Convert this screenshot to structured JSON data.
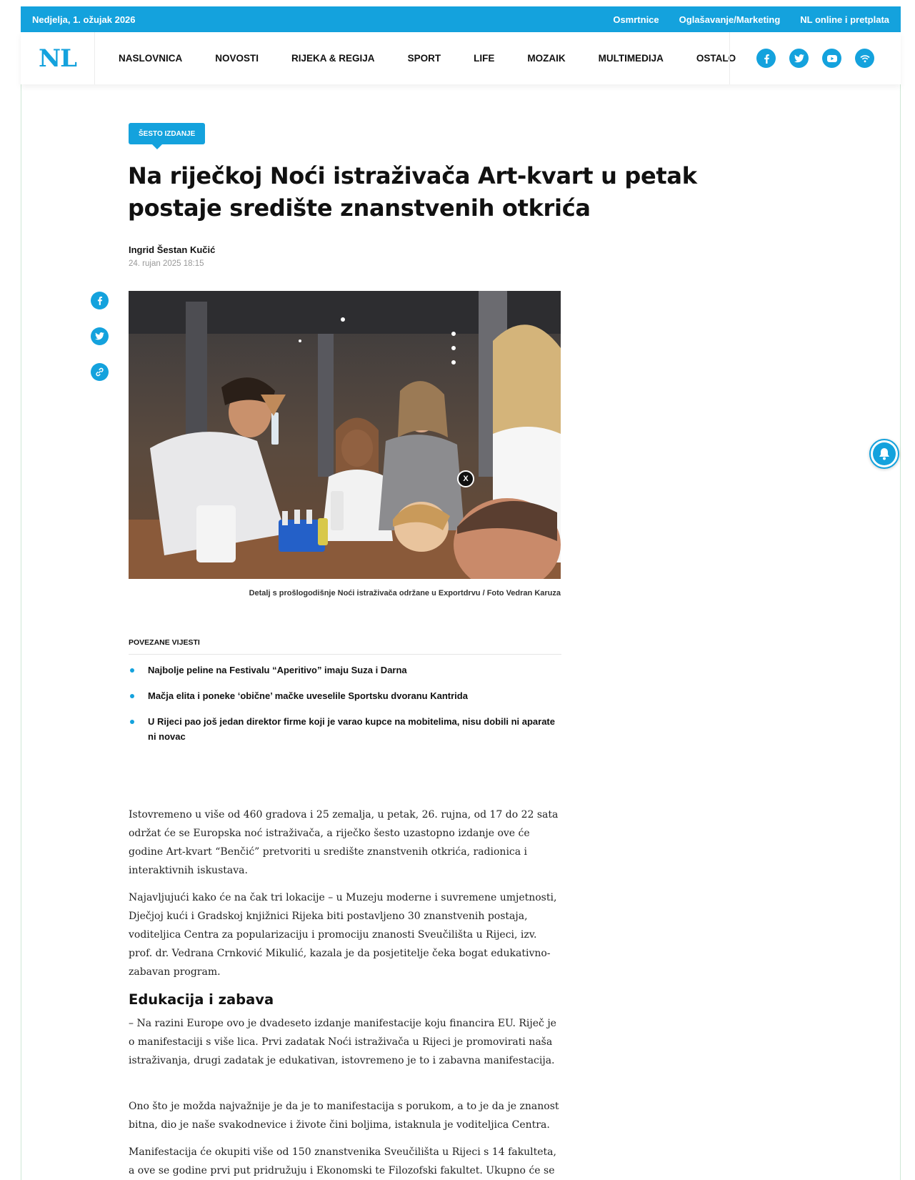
{
  "topbar": {
    "date": "Nedjelja, 1. ožujak 2026",
    "links": [
      "Osmrtnice",
      "Oglašavanje/Marketing",
      "NL online i pretplata"
    ]
  },
  "nav": {
    "logo": "NL",
    "items": [
      "NASLOVNICA",
      "NOVOSTI",
      "RIJEKA & REGIJA",
      "SPORT",
      "LIFE",
      "MOZAIK",
      "MULTIMEDIJA",
      "OSTALO"
    ],
    "social": [
      {
        "icon": "facebook-icon",
        "glyph": "f"
      },
      {
        "icon": "twitter-icon",
        "glyph": "t"
      },
      {
        "icon": "youtube-icon",
        "glyph": "▶"
      },
      {
        "icon": "rss-icon",
        "glyph": "◉"
      }
    ]
  },
  "article": {
    "badge": "ŠESTO IZDANJE",
    "title": "Na riječkoj Noći istraživača Art-kvart u petak postaje središte znanstvenih otkrića",
    "author": "Ingrid Šestan Kučić",
    "date": "24. rujan 2025 18:15",
    "caption": "Detalj s prošlogodišnje Noći istraživača održane u Exportdrvu / Foto Vedran Karuza",
    "close_label": "X",
    "related_heading": "POVEZANE VIJESTI",
    "related": [
      "Najbolje peline na Festivalu “Aperitivo” imaju Suza i Darna",
      "Mačja elita i poneke ‘obične’ mačke uveselile Sportsku dvoranu Kantrida",
      "U Rijeci pao još jedan direktor firme koji je varao kupce na mobitelima, nisu dobili ni aparate ni novac"
    ],
    "body": {
      "p1": "Istovremeno u više od 460 gradova i 25 zemalja, u petak, 26. rujna, od 17 do 22 sata održat će se Europska noć istraživača, a riječko šesto uzastopno izdanje ove će godine Art-kvart “Benčić” pretvoriti u središte znanstvenih otkrića, radionica i interaktivnih iskustava.",
      "p2": "Najavljujući kako će na čak tri lokacije – u Muzeju moderne i suvremene umjetnosti, Dječjoj kući i Gradskoj knjižnici Rijeka biti postavljeno 30 znanstvenih postaja, voditeljica Centra za popularizaciju i promociju znanosti Sveučilišta u Rijeci, izv. prof. dr. Vedrana Crnković Mikulić, kazala je da posjetitelje čeka bogat edukativno-zabavan program.",
      "h2": "Edukacija i zabava",
      "p3": "– Na razini Europe ovo je dvadeseto izdanje manifestacije koju financira EU. Riječ je o manifestaciji s više lica. Prvi zadatak Noći istraživača u Rijeci je promovirati naša istraživanja, drugi zadatak je edukativan, istovremeno je to i zabavna manifestacija.",
      "p4": "Ono što je možda najvažnije je da je to manifestacija s porukom, a to je da je znanost bitna, dio je naše svakodnevice i životе čini boljima, istaknula je voditeljica Centra.",
      "p5": "Manifestacija će okupiti više od 150 znanstvenika Sveučilišta u Rijeci s 14 fakulteta, a ove se godine prvi put pridružuju i Ekonomski te Filozofski fakultet. Ukupno će se"
    }
  },
  "colors": {
    "accent": "#14a2dd"
  }
}
